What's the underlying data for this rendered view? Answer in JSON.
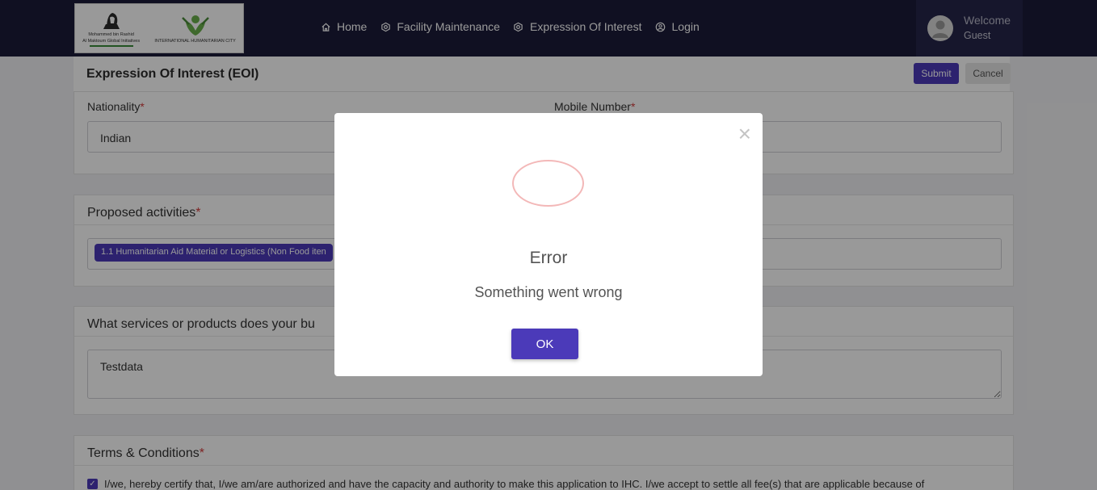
{
  "nav": {
    "items": [
      {
        "label": "Home",
        "icon": "home-icon"
      },
      {
        "label": "Facility Maintenance",
        "icon": "hexagon-gear-icon"
      },
      {
        "label": "Expression Of Interest",
        "icon": "hexagon-gear-icon"
      },
      {
        "label": "Login",
        "icon": "user-circle-icon"
      }
    ]
  },
  "logo": {
    "left_text_1": "Mohammed bin Rashid",
    "left_text_2": "Al Maktoum Global Initiatives",
    "right_text": "INTERNATIONAL HUMANITARIAN CITY"
  },
  "user": {
    "welcome": "Welcome",
    "name": "Guest"
  },
  "page": {
    "title": "Expression Of Interest (EOI)",
    "submit_label": "Submit",
    "cancel_label": "Cancel"
  },
  "form": {
    "nationality_label": "Nationality",
    "nationality_value": "Indian",
    "mobile_label": "Mobile Number",
    "required_mark": "*",
    "activities_title": "Proposed activities",
    "activity_chip": "1.1 Humanitarian Aid Material or Logistics (Non Food iten",
    "services_title": "What services or products does your bu",
    "services_value": "Testdata",
    "terms_title": "Terms & Conditions",
    "terms_text": "I/we, hereby certify that, I/we am/are authorized and have the capacity and authority to make this application to IHC. I/we accept to settle all fee(s) that are applicable because of"
  },
  "modal": {
    "close_glyph": "×",
    "title": "Error",
    "message": "Something went wrong",
    "ok_label": "OK"
  },
  "colors": {
    "nav_bg": "#1c1c3a",
    "primary": "#4b3ab9",
    "error_ring": "#f3b8b8"
  }
}
